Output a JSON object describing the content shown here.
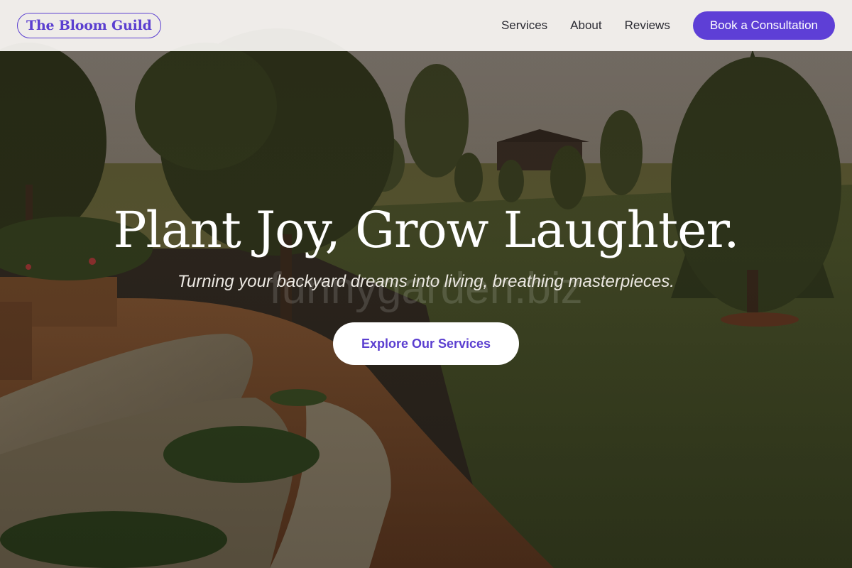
{
  "header": {
    "logo": "The Bloom Guild",
    "nav": [
      {
        "label": "Services"
      },
      {
        "label": "About"
      },
      {
        "label": "Reviews"
      }
    ],
    "cta_label": "Book a Consultation"
  },
  "hero": {
    "title": "Plant Joy, Grow Laughter.",
    "subtitle": "Turning your backyard dreams into living, breathing masterpieces.",
    "watermark": "funnygarden.biz",
    "button_label": "Explore Our Services"
  },
  "colors": {
    "brand": "#5e3fd6",
    "header_bg": "#f6f4f1",
    "hero_text": "#ffffff"
  }
}
